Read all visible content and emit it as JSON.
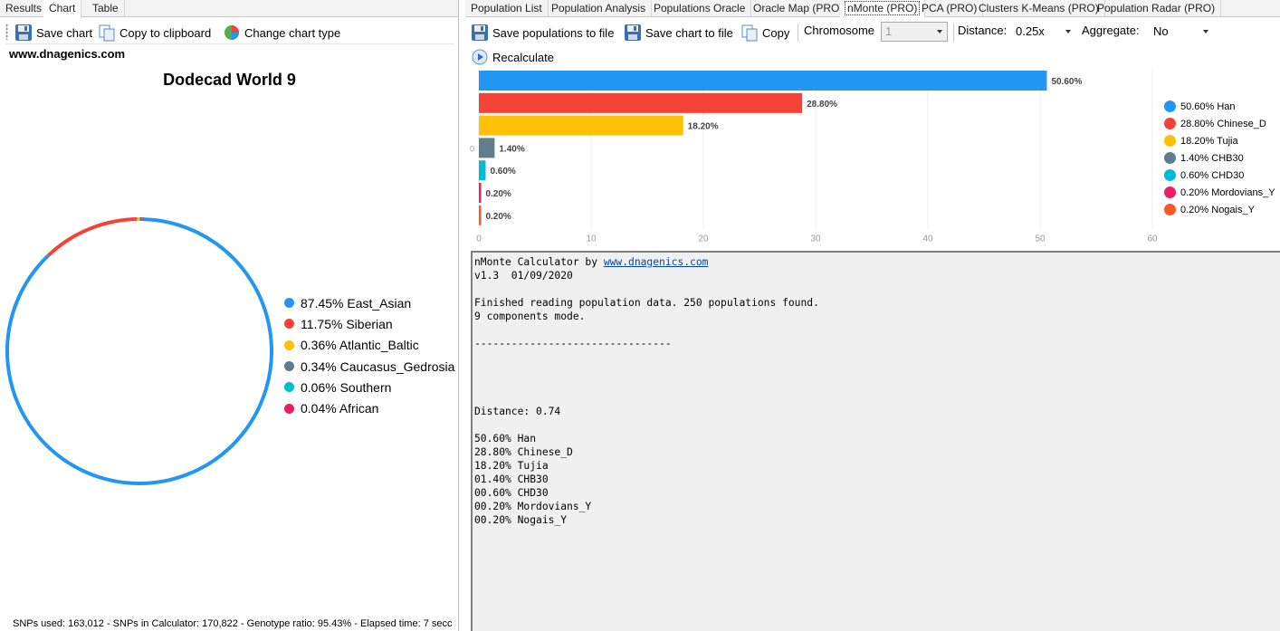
{
  "left_panel": {
    "tabs": [
      {
        "label": "Results",
        "active": false
      },
      {
        "label": "Chart",
        "active": true
      },
      {
        "label": "Table",
        "active": false
      }
    ],
    "toolbar": {
      "save_chart": "Save chart",
      "copy_clipboard": "Copy to clipboard",
      "change_type": "Change chart type"
    },
    "site": "www.dnagenics.com",
    "status": "SNPs used: 163,012 - SNPs in Calculator: 170,822 - Genotype ratio: 95.43% - Elapsed time: 7 secc"
  },
  "right_panel": {
    "tabs": [
      {
        "label": "Population List"
      },
      {
        "label": "Population Analysis"
      },
      {
        "label": "Populations Oracle"
      },
      {
        "label": "Oracle Map (PRO)"
      },
      {
        "label": "nMonte (PRO)",
        "active": true
      },
      {
        "label": "PCA (PRO)"
      },
      {
        "label": "Clusters K-Means (PRO)"
      },
      {
        "label": "Population Radar (PRO)"
      }
    ],
    "toolbar": {
      "save_populations": "Save populations to file",
      "save_chart": "Save chart to file",
      "copy": "Copy",
      "chromosome_label": "Chromosome",
      "chromosome_value": "1",
      "distance_label": "Distance:",
      "distance_value": "0.25x",
      "aggregate_label": "Aggregate:",
      "aggregate_value": "No",
      "recalculate": "Recalculate"
    },
    "console": {
      "line1_prefix": "nMonte Calculator by ",
      "line1_link": "www.dnagenics.com",
      "body": "v1.3  01/09/2020\n\nFinished reading population data. 250 populations found.\n9 components mode.\n\n--------------------------------\n\n\n\n\nDistance: 0.74\n\n50.60% Han\n28.80% Chinese_D\n18.20% Tujia\n01.40% CHB30\n00.60% CHD30\n00.20% Mordovians_Y\n00.20% Nogais_Y"
    }
  },
  "chart_data": [
    {
      "type": "pie",
      "title": "Dodecad World 9",
      "categories": [
        "East_Asian",
        "Siberian",
        "Atlantic_Baltic",
        "Caucasus_Gedrosia",
        "Southern",
        "African"
      ],
      "values": [
        87.45,
        11.75,
        0.36,
        0.34,
        0.06,
        0.04
      ],
      "legend_labels": [
        "87.45% East_Asian",
        "11.75% Siberian",
        "0.36% Atlantic_Baltic",
        "0.34% Caucasus_Gedrosia",
        "0.06% Southern",
        "0.04% African"
      ],
      "colors": [
        "#2196f3",
        "#f44336",
        "#ffc107",
        "#607d8b",
        "#00bcd4",
        "#e91e63"
      ],
      "legend_position": "right"
    },
    {
      "type": "bar",
      "orientation": "horizontal",
      "categories": [
        "Han",
        "Chinese_D",
        "Tujia",
        "CHB30",
        "CHD30",
        "Mordovians_Y",
        "Nogais_Y"
      ],
      "values": [
        50.6,
        28.8,
        18.2,
        1.4,
        0.6,
        0.2,
        0.2
      ],
      "data_labels": [
        "50.60%",
        "28.80%",
        "18.20%",
        "1.40%",
        "0.60%",
        "0.20%",
        "0.20%"
      ],
      "legend_labels": [
        "50.60% Han",
        "28.80% Chinese_D",
        "18.20% Tujia",
        "1.40% CHB30",
        "0.60% CHD30",
        "0.20% Mordovians_Y",
        "0.20% Nogais_Y"
      ],
      "colors": [
        "#2196f3",
        "#f44336",
        "#ffc107",
        "#607d8b",
        "#00bcd4",
        "#e91e63",
        "#ff5722"
      ],
      "xlim": [
        0,
        60
      ],
      "x_ticks": [
        0,
        10,
        20,
        30,
        40,
        50,
        60
      ],
      "y_axis_label": "0",
      "grid": true,
      "legend_position": "right"
    }
  ]
}
